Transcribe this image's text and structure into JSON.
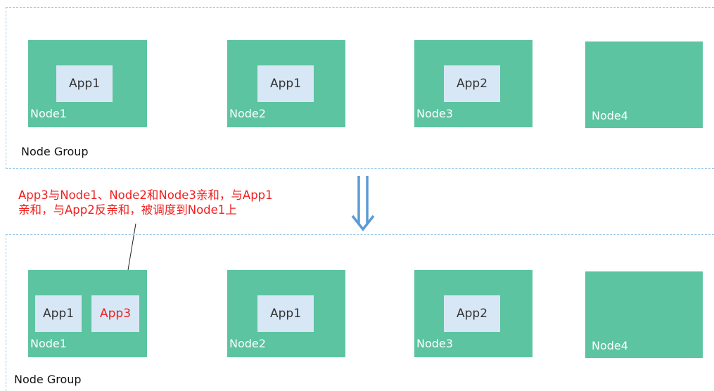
{
  "top_group": {
    "label": "Node Group",
    "nodes": [
      {
        "label": "Node1",
        "apps": [
          "App1"
        ]
      },
      {
        "label": "Node2",
        "apps": [
          "App1"
        ]
      },
      {
        "label": "Node3",
        "apps": [
          "App2"
        ]
      },
      {
        "label": "Node4",
        "apps": []
      }
    ]
  },
  "annotation": {
    "line1": "App3与Node1、Node2和Node3亲和，与App1",
    "line2": "亲和，与App2反亲和，被调度到Node1上"
  },
  "bottom_group": {
    "label": "Node Group",
    "nodes": [
      {
        "label": "Node1",
        "apps": [
          "App1",
          "App3"
        ]
      },
      {
        "label": "Node2",
        "apps": [
          "App1"
        ]
      },
      {
        "label": "Node3",
        "apps": [
          "App2"
        ]
      },
      {
        "label": "Node4",
        "apps": []
      }
    ]
  },
  "colors": {
    "node": "#5cc4a0",
    "app": "#d8e7f5",
    "highlight": "#f01e1e",
    "arrow": "#5b9bd5",
    "dash": "#9cc9e8"
  }
}
